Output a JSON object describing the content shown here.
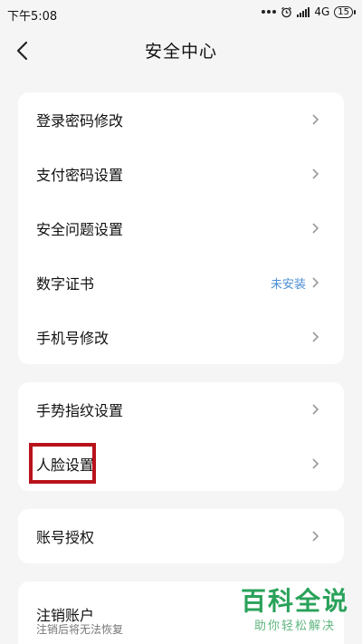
{
  "status_bar": {
    "time": "下午5:08",
    "network": "4G",
    "battery": "15"
  },
  "header": {
    "title": "安全中心"
  },
  "group1": {
    "items": [
      {
        "label": "登录密码修改",
        "value": ""
      },
      {
        "label": "支付密码设置",
        "value": ""
      },
      {
        "label": "安全问题设置",
        "value": ""
      },
      {
        "label": "数字证书",
        "value": "未安装"
      },
      {
        "label": "手机号修改",
        "value": ""
      }
    ]
  },
  "group2": {
    "items": [
      {
        "label": "手势指纹设置"
      },
      {
        "label": "人脸设置"
      }
    ]
  },
  "group3": {
    "items": [
      {
        "label": "账号授权"
      }
    ]
  },
  "group4": {
    "title": "注销账户",
    "subtitle": "注销后将无法恢复"
  },
  "watermark": {
    "main": "百科全说",
    "sub": "助你轻松解决"
  },
  "colors": {
    "highlight": "#b8121a",
    "link_blue": "#4a8fd6",
    "watermark_green": "#2aa25a"
  }
}
